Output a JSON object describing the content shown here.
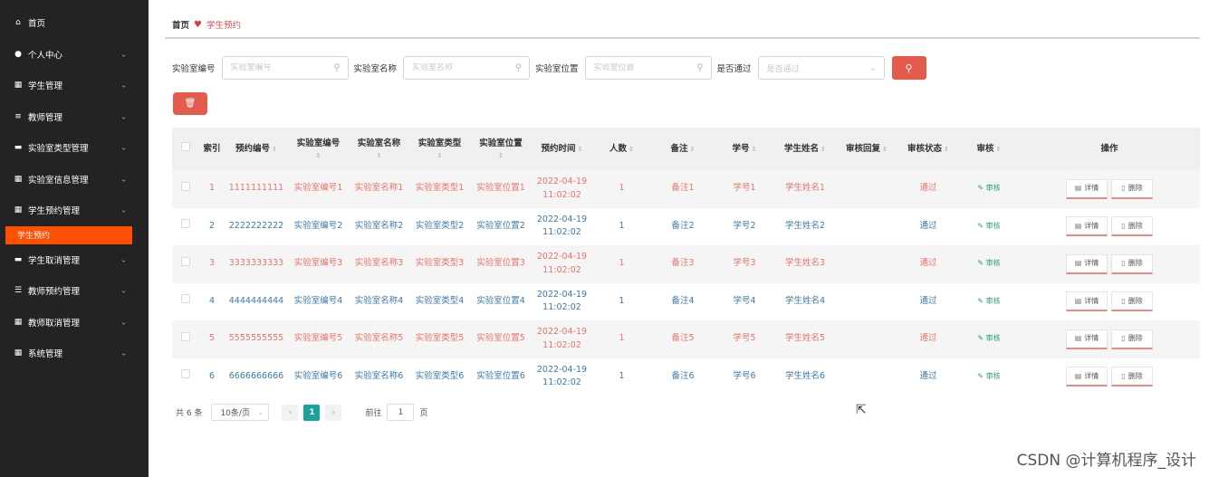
{
  "sidebar": {
    "items": [
      {
        "label": "首页",
        "icon": "home-icon",
        "glyph": "⌂",
        "expandable": false
      },
      {
        "label": "个人中心",
        "icon": "user-icon",
        "glyph": "●",
        "expandable": true
      },
      {
        "label": "学生管理",
        "icon": "grid-icon",
        "glyph": "▦",
        "expandable": true
      },
      {
        "label": "教师管理",
        "icon": "list-icon",
        "glyph": "≡",
        "expandable": true
      },
      {
        "label": "实验室类型管理",
        "icon": "bookmark-icon",
        "glyph": "▬",
        "expandable": true
      },
      {
        "label": "实验室信息管理",
        "icon": "table-icon",
        "glyph": "▦",
        "expandable": true
      },
      {
        "label": "学生预约管理",
        "icon": "grid-icon",
        "glyph": "▦",
        "expandable": true
      },
      {
        "label": "学生取消管理",
        "icon": "ticket-icon",
        "glyph": "▬",
        "expandable": true
      },
      {
        "label": "教师预约管理",
        "icon": "sliders-icon",
        "glyph": "☰",
        "expandable": true
      },
      {
        "label": "教师取消管理",
        "icon": "grid-icon",
        "glyph": "▦",
        "expandable": true
      },
      {
        "label": "系统管理",
        "icon": "grid-icon",
        "glyph": "▦",
        "expandable": true
      }
    ],
    "active_sub": "学生预约",
    "chevron": "⌄"
  },
  "breadcrumb": {
    "home": "首页",
    "separator_icon": "heart-icon",
    "separator_glyph": "♥",
    "current": "学生预约"
  },
  "search": {
    "fields": [
      {
        "label": "实验室编号",
        "placeholder": "实验室编号",
        "value": ""
      },
      {
        "label": "实验室名称",
        "placeholder": "实验室名称",
        "value": ""
      },
      {
        "label": "实验室位置",
        "placeholder": "实验室位置",
        "value": ""
      }
    ],
    "select": {
      "label": "是否通过",
      "placeholder": "是否通过"
    },
    "search_icon": "⚲",
    "delete_icon": "🗑"
  },
  "table": {
    "headers": [
      "索引",
      "预约编号",
      "实验室编号",
      "实验室名称",
      "实验室类型",
      "实验室位置",
      "预约时间",
      "人数",
      "备注",
      "学号",
      "学生姓名",
      "审核回复",
      "审核状态",
      "审核",
      "操作"
    ],
    "sort_glyph": "⇕",
    "rows": [
      {
        "index": "1",
        "code": "1111111111",
        "lab_no": "实验室编号1",
        "lab_name": "实验室名称1",
        "lab_type": "实验室类型1",
        "lab_loc": "实验室位置1",
        "time1": "2022-04-19",
        "time2": "11:02:02",
        "count": "1",
        "remark": "备注1",
        "sno": "学号1",
        "sname": "学生姓名1",
        "reply": "",
        "status": "通过",
        "audit": "审核",
        "detail": "详情",
        "delete": "删除"
      },
      {
        "index": "2",
        "code": "2222222222",
        "lab_no": "实验室编号2",
        "lab_name": "实验室名称2",
        "lab_type": "实验室类型2",
        "lab_loc": "实验室位置2",
        "time1": "2022-04-19",
        "time2": "11:02:02",
        "count": "1",
        "remark": "备注2",
        "sno": "学号2",
        "sname": "学生姓名2",
        "reply": "",
        "status": "通过",
        "audit": "审核",
        "detail": "详情",
        "delete": "删除"
      },
      {
        "index": "3",
        "code": "3333333333",
        "lab_no": "实验室编号3",
        "lab_name": "实验室名称3",
        "lab_type": "实验室类型3",
        "lab_loc": "实验室位置3",
        "time1": "2022-04-19",
        "time2": "11:02:02",
        "count": "1",
        "remark": "备注3",
        "sno": "学号3",
        "sname": "学生姓名3",
        "reply": "",
        "status": "通过",
        "audit": "审核",
        "detail": "详情",
        "delete": "删除"
      },
      {
        "index": "4",
        "code": "4444444444",
        "lab_no": "实验室编号4",
        "lab_name": "实验室名称4",
        "lab_type": "实验室类型4",
        "lab_loc": "实验室位置4",
        "time1": "2022-04-19",
        "time2": "11:02:02",
        "count": "1",
        "remark": "备注4",
        "sno": "学号4",
        "sname": "学生姓名4",
        "reply": "",
        "status": "通过",
        "audit": "审核",
        "detail": "详情",
        "delete": "删除"
      },
      {
        "index": "5",
        "code": "5555555555",
        "lab_no": "实验室编号5",
        "lab_name": "实验室名称5",
        "lab_type": "实验室类型5",
        "lab_loc": "实验室位置5",
        "time1": "2022-04-19",
        "time2": "11:02:02",
        "count": "1",
        "remark": "备注5",
        "sno": "学号5",
        "sname": "学生姓名5",
        "reply": "",
        "status": "通过",
        "audit": "审核",
        "detail": "详情",
        "delete": "删除"
      },
      {
        "index": "6",
        "code": "6666666666",
        "lab_no": "实验室编号6",
        "lab_name": "实验室名称6",
        "lab_type": "实验室类型6",
        "lab_loc": "实验室位置6",
        "time1": "2022-04-19",
        "time2": "11:02:02",
        "count": "1",
        "remark": "备注6",
        "sno": "学号6",
        "sname": "学生姓名6",
        "reply": "",
        "status": "通过",
        "audit": "审核",
        "detail": "详情",
        "delete": "删除"
      }
    ]
  },
  "pagination": {
    "total": "共 6 条",
    "page_size": "10条/页",
    "prev": "‹",
    "current": "1",
    "next": "›",
    "goto_label": "前往",
    "goto_value": "1",
    "page_suffix": "页"
  },
  "watermark": "CSDN @计算机程序_设计",
  "colors": {
    "sidebar_bg": "#232323",
    "active": "#ff5000",
    "accent": "#e45a4c",
    "link_blue": "#3e78ad",
    "link_red": "#e9746a",
    "pager_active": "#1aa39a"
  }
}
